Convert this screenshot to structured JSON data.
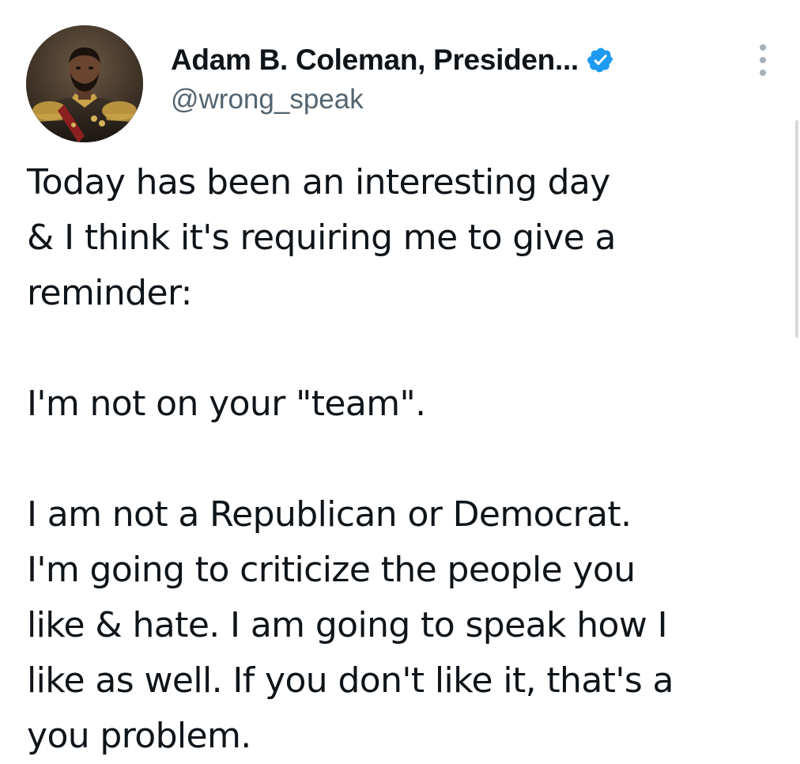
{
  "tweet": {
    "author": {
      "display_name": "Adam B. Coleman, Presiden...",
      "handle": "@wrong_speak",
      "verified": true,
      "avatar_icon": "profile-photo-avatar"
    },
    "menu_icon": "more-vertical-icon",
    "paragraphs": [
      {
        "lines": [
          "Today has been an interesting day",
          "& I think it's requiring me to give a",
          "reminder:"
        ]
      },
      {
        "lines": [
          "I'm not on your \"team\"."
        ]
      },
      {
        "lines": [
          "I am not a Republican or Democrat.",
          "I'm going to criticize the people you",
          "like & hate. I am going to speak how I",
          "like as well. If you don't like it, that's a",
          "you problem."
        ]
      }
    ]
  },
  "colors": {
    "text": "#0f1419",
    "secondary": "#536471",
    "verified_badge": "#1d9bf0",
    "background": "#ffffff"
  }
}
